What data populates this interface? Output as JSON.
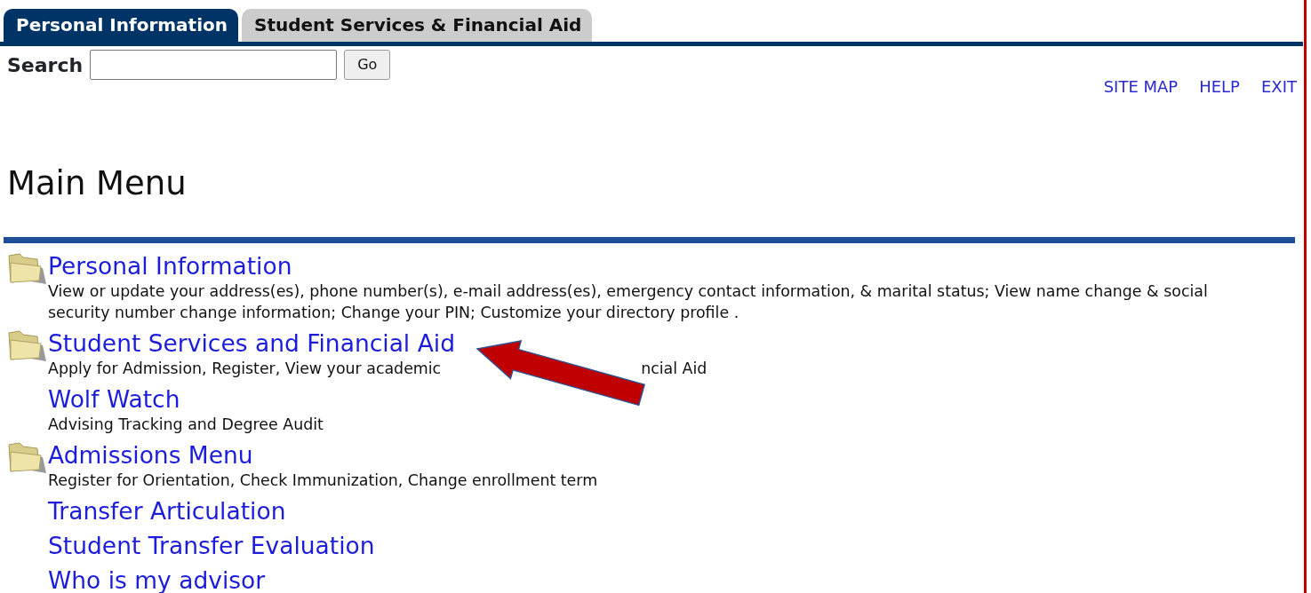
{
  "tabs": [
    {
      "label": "Personal Information",
      "selected": true
    },
    {
      "label": "Student Services & Financial Aid",
      "selected": false
    }
  ],
  "search": {
    "label": "Search",
    "button": "Go"
  },
  "top_links": [
    "SITE MAP",
    "HELP",
    "EXIT"
  ],
  "heading": "Main Menu",
  "menu": [
    {
      "title": "Personal Information",
      "folder": true,
      "description": [
        "View or update your address(es), phone number(s), e-mail address(es), emergency contact information, & marital status; View name change & social security number change information; Change your PIN; Customize your directory profile ."
      ]
    },
    {
      "title": "Student Services and Financial Aid",
      "folder": true,
      "description": [
        "Apply for Admission, Register, View your academic",
        "ncial Aid"
      ],
      "arrow": true
    },
    {
      "title": "Wolf Watch",
      "folder": false,
      "description": [
        "Advising Tracking and Degree Audit"
      ]
    },
    {
      "title": "Admissions Menu",
      "folder": true,
      "description": [
        "Register for Orientation, Check Immunization, Change enrollment term"
      ]
    },
    {
      "title": "Transfer Articulation",
      "folder": false
    },
    {
      "title": "Student Transfer Evaluation",
      "folder": false
    },
    {
      "title": "Who is my advisor",
      "folder": false
    }
  ]
}
